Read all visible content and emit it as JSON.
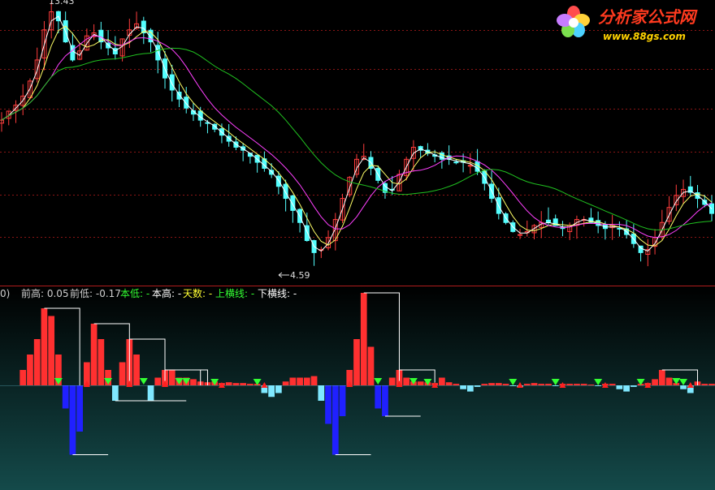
{
  "logo": {
    "title": "分析家公式网",
    "url": "www.88gs.com",
    "colors": {
      "title": "#ff3a1f",
      "url": "#ffd200",
      "petals": [
        "#ff4d4d",
        "#ffd23a",
        "#4dd2ff",
        "#7be04d",
        "#c77dff"
      ]
    }
  },
  "price_panel": {
    "high_label": "13.43",
    "low_label": "4.59",
    "colors": {
      "up": "#ff3c3c",
      "down": "#54ffff",
      "ma_short": "#ffffff",
      "ma_mid": "#ffff66",
      "ma_long": "#ff40ff",
      "ma_slow": "#20c020",
      "grid": "#8a1515",
      "divider": "#b01c1c"
    }
  },
  "indicator_panel": {
    "legend": [
      {
        "key": "idx",
        "text": "0)",
        "color": "#cfcfcf"
      },
      {
        "key": "prev_high",
        "text": "前高: 0.05",
        "color": "#cfcfcf"
      },
      {
        "key": "prev_low",
        "text": "前低: -0.17",
        "color": "#cfcfcf"
      },
      {
        "key": "cur_low",
        "text": "本低: -",
        "color": "#33ff33"
      },
      {
        "key": "cur_high",
        "text": "本高: -",
        "color": "#ffffff"
      },
      {
        "key": "days",
        "text": "天数: -",
        "color": "#ffff33"
      },
      {
        "key": "upper_line",
        "text": "上横线: -",
        "color": "#33ff33"
      },
      {
        "key": "lower_line",
        "text": "下横线: -",
        "color": "#ffffff"
      }
    ],
    "colors": {
      "pos": "#ff3030",
      "neg": "#7fe8ff",
      "pos_strong": "#ffee00",
      "neg_strong": "#2020ff",
      "line": "#ffffff",
      "up_marker": "#33ff33",
      "down_marker": "#ff2020",
      "bg_top": "#000000",
      "bg_bottom": "#144a4a"
    }
  },
  "chart_data": {
    "type": "line",
    "title": "",
    "xlabel": "",
    "ylabel": "",
    "ylim": [
      4.59,
      13.43
    ],
    "grid": true,
    "series": [
      {
        "values": [
          9.6,
          9.9,
          10.1,
          10.4,
          10.9,
          11.6,
          12.6,
          13.2,
          12.9,
          12.2,
          11.6,
          11.9,
          12.4,
          12.5,
          12.2,
          12.0,
          11.8,
          12.3,
          12.6,
          12.8,
          12.5,
          12.2,
          11.6,
          11.0,
          10.6,
          10.3,
          10.0,
          9.8,
          9.6,
          9.5,
          9.3,
          9.1,
          8.9,
          8.7,
          8.6,
          8.4,
          8.2,
          8.0,
          7.8,
          7.4,
          7.0,
          6.6,
          6.2,
          5.6,
          5.2,
          5.3,
          5.7,
          6.3,
          7.0,
          7.7,
          8.3,
          8.4,
          8.0,
          7.6,
          7.2,
          7.3,
          7.8,
          8.3,
          8.7,
          8.6,
          8.5,
          8.4,
          8.3,
          8.3,
          8.2,
          8.2,
          8.1,
          7.9,
          7.5,
          7.0,
          6.5,
          6.2,
          5.9,
          5.8,
          5.9,
          6.1,
          6.2,
          6.2,
          6.1,
          6.0,
          6.1,
          6.3,
          6.3,
          6.2,
          6.1,
          6.0,
          6.1,
          6.0,
          5.8,
          5.5,
          5.2,
          5.3,
          5.7,
          6.2,
          6.7,
          7.1,
          7.3,
          7.2,
          7.0,
          6.8,
          6.5
        ]
      },
      {
        "values": [
          0,
          0,
          0,
          0.2,
          0.4,
          0.6,
          1.0,
          0.9,
          0.4,
          -0.3,
          -0.9,
          -0.6,
          0.3,
          0.8,
          0.6,
          0.2,
          -0.2,
          0.3,
          0.6,
          0.4,
          0,
          -0.2,
          0.1,
          0.2,
          0.2,
          0.1,
          0.1,
          0.08,
          0.05,
          0.04,
          0.05,
          0.03,
          0.04,
          0.03,
          0.03,
          0.02,
          0.02,
          -0.1,
          -0.15,
          -0.1,
          0.05,
          0.1,
          0.1,
          0.1,
          0.12,
          -0.2,
          -0.5,
          -0.9,
          -0.4,
          0.2,
          0.6,
          1.2,
          0.5,
          -0.3,
          -0.4,
          0.1,
          0.2,
          0.1,
          0.05,
          0.05,
          0.04,
          0.03,
          0.1,
          0.04,
          0.02,
          -0.05,
          -0.08,
          -0.02,
          0.02,
          0.03,
          0.03,
          0.02,
          -0.01,
          -0.02,
          0.02,
          0.03,
          0.02,
          0.02,
          -0.01,
          0.02,
          0.02,
          0.02,
          0.02,
          0.01,
          -0.01,
          0.02,
          0.02,
          -0.05,
          -0.08,
          -0.02,
          0.02,
          0.03,
          0.08,
          0.2,
          0.1,
          0.03,
          -0.05,
          -0.1,
          0.05,
          0.02,
          0.02
        ]
      }
    ]
  }
}
